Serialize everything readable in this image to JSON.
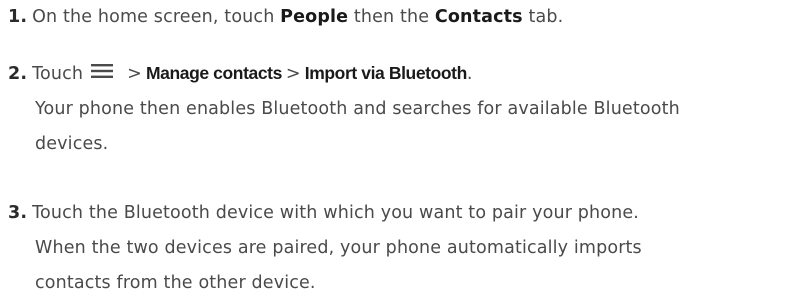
{
  "steps": [
    {
      "number": "1.",
      "parts": {
        "t1": "On the home screen, touch ",
        "b1": "People",
        "t2": " then the ",
        "b2": "Contacts",
        "t3": " tab."
      }
    },
    {
      "number": "2.",
      "parts": {
        "t1": "Touch",
        "icon": "menu-icon",
        "sep1": ">",
        "b1": "Manage contacts",
        "sep2": ">",
        "b2": "Import via Bluetooth",
        "t2": "."
      },
      "lines": [
        "Your phone then enables Bluetooth and searches for available Bluetooth",
        "devices."
      ]
    },
    {
      "number": "3.",
      "first_line": "Touch the Bluetooth device with which you want to pair your phone.",
      "lines": [
        "When the two devices are paired, your phone automatically imports",
        "contacts from the other device."
      ]
    }
  ]
}
